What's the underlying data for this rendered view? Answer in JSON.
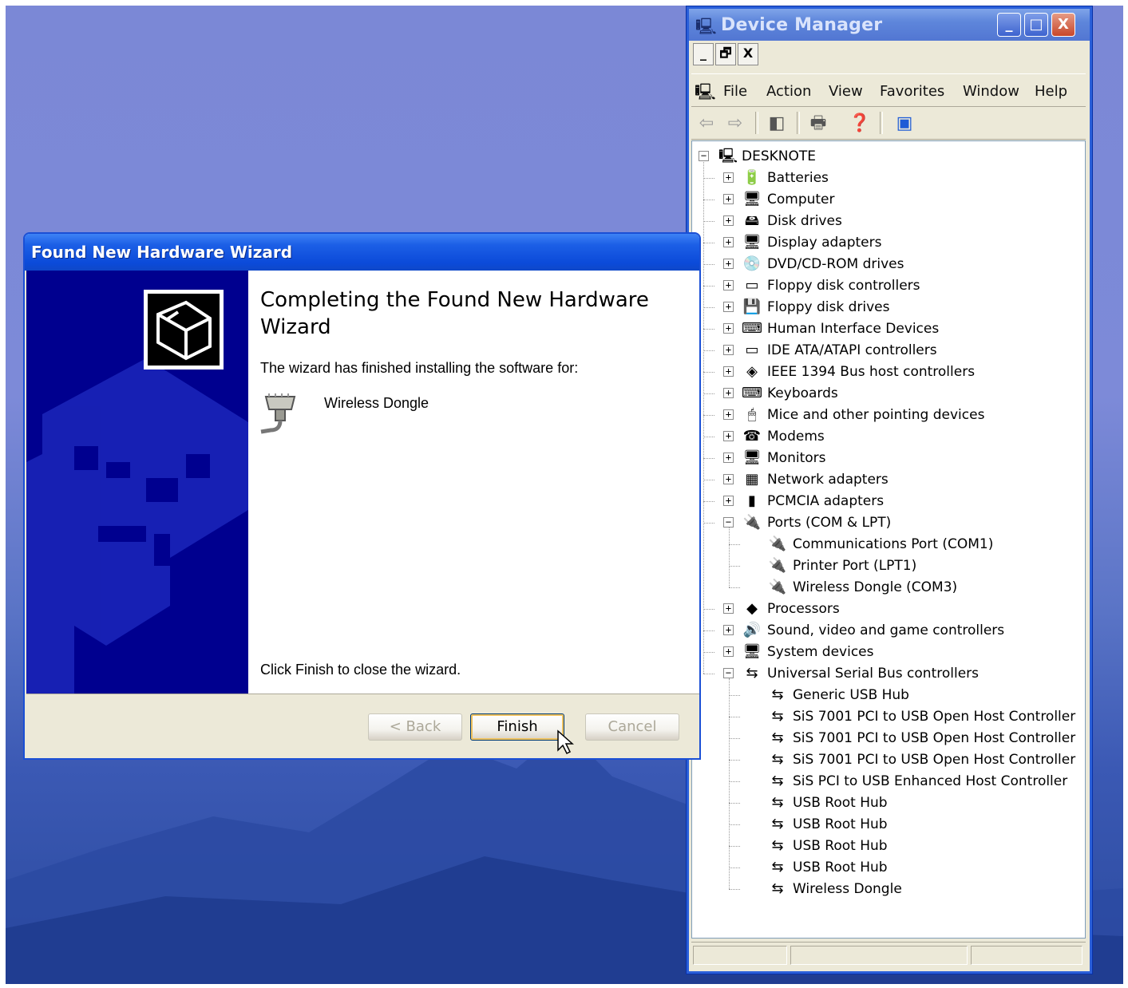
{
  "device_manager": {
    "title": "Device Manager",
    "window_buttons": {
      "minimize": "_",
      "maximize": "□",
      "close": "X"
    },
    "mdi_buttons": {
      "minimize": "_",
      "restore": "🗗",
      "close": "X"
    },
    "menu": [
      "File",
      "Action",
      "View",
      "Favorites",
      "Window",
      "Help"
    ],
    "root": "DESKNOTE",
    "categories": [
      {
        "label": "Batteries",
        "icon": "battery-icon",
        "glyph": "🔋",
        "expanded": false
      },
      {
        "label": "Computer",
        "icon": "computer-icon",
        "glyph": "🖥",
        "expanded": false
      },
      {
        "label": "Disk drives",
        "icon": "disk-drive-icon",
        "glyph": "🖴",
        "expanded": false
      },
      {
        "label": "Display adapters",
        "icon": "display-adapter-icon",
        "glyph": "🖥",
        "expanded": false
      },
      {
        "label": "DVD/CD-ROM drives",
        "icon": "cd-drive-icon",
        "glyph": "💿",
        "expanded": false
      },
      {
        "label": "Floppy disk controllers",
        "icon": "controller-icon",
        "glyph": "▭",
        "expanded": false
      },
      {
        "label": "Floppy disk drives",
        "icon": "floppy-drive-icon",
        "glyph": "💾",
        "expanded": false
      },
      {
        "label": "Human Interface Devices",
        "icon": "hid-icon",
        "glyph": "⌨",
        "expanded": false
      },
      {
        "label": "IDE ATA/ATAPI controllers",
        "icon": "ide-controller-icon",
        "glyph": "▭",
        "expanded": false
      },
      {
        "label": "IEEE 1394 Bus host controllers",
        "icon": "ieee1394-icon",
        "glyph": "◈",
        "expanded": false
      },
      {
        "label": "Keyboards",
        "icon": "keyboard-icon",
        "glyph": "⌨",
        "expanded": false
      },
      {
        "label": "Mice and other pointing devices",
        "icon": "mouse-icon",
        "glyph": "🖱",
        "expanded": false
      },
      {
        "label": "Modems",
        "icon": "modem-icon",
        "glyph": "☎",
        "expanded": false
      },
      {
        "label": "Monitors",
        "icon": "monitor-icon",
        "glyph": "🖥",
        "expanded": false
      },
      {
        "label": "Network adapters",
        "icon": "network-adapter-icon",
        "glyph": "▦",
        "expanded": false
      },
      {
        "label": "PCMCIA adapters",
        "icon": "pcmcia-icon",
        "glyph": "▮",
        "expanded": false
      },
      {
        "label": "Ports (COM & LPT)",
        "icon": "port-icon",
        "glyph": "🔌",
        "expanded": true,
        "children": [
          "Communications Port (COM1)",
          "Printer Port (LPT1)",
          "Wireless Dongle (COM3)"
        ]
      },
      {
        "label": "Processors",
        "icon": "processor-icon",
        "glyph": "◆",
        "expanded": false
      },
      {
        "label": "Sound, video and game controllers",
        "icon": "sound-icon",
        "glyph": "🔊",
        "expanded": false
      },
      {
        "label": "System devices",
        "icon": "system-devices-icon",
        "glyph": "🖥",
        "expanded": false
      },
      {
        "label": "Universal Serial Bus controllers",
        "icon": "usb-icon",
        "glyph": "⇆",
        "expanded": true,
        "children": [
          "Generic USB Hub",
          "SiS 7001 PCI to USB Open Host Controller",
          "SiS 7001 PCI to USB Open Host Controller",
          "SiS 7001 PCI to USB Open Host Controller",
          "SiS PCI to USB Enhanced Host Controller",
          "USB Root Hub",
          "USB Root Hub",
          "USB Root Hub",
          "USB Root Hub",
          "Wireless Dongle"
        ]
      }
    ]
  },
  "wizard": {
    "title": "Found New Hardware Wizard",
    "heading": "Completing the Found New Hardware Wizard",
    "intro": "The wizard has finished installing the software for:",
    "device_name": "Wireless Dongle",
    "footer_text": "Click Finish to close the wizard.",
    "buttons": {
      "back": "< Back",
      "finish": "Finish",
      "cancel": "Cancel"
    }
  },
  "colors": {
    "xp_blue": "#0b4ad9",
    "wizard_side": "#00008f",
    "window_face": "#ece9d8"
  }
}
